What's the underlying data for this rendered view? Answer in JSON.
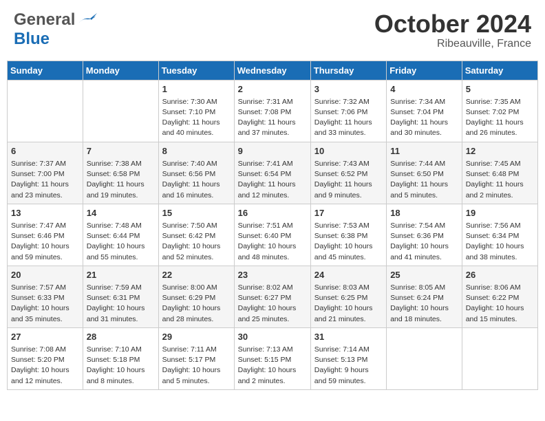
{
  "header": {
    "logo_general": "General",
    "logo_blue": "Blue",
    "month": "October 2024",
    "location": "Ribeauville, France"
  },
  "days_of_week": [
    "Sunday",
    "Monday",
    "Tuesday",
    "Wednesday",
    "Thursday",
    "Friday",
    "Saturday"
  ],
  "weeks": [
    [
      {
        "day": "",
        "info": ""
      },
      {
        "day": "",
        "info": ""
      },
      {
        "day": "1",
        "info": "Sunrise: 7:30 AM\nSunset: 7:10 PM\nDaylight: 11 hours\nand 40 minutes."
      },
      {
        "day": "2",
        "info": "Sunrise: 7:31 AM\nSunset: 7:08 PM\nDaylight: 11 hours\nand 37 minutes."
      },
      {
        "day": "3",
        "info": "Sunrise: 7:32 AM\nSunset: 7:06 PM\nDaylight: 11 hours\nand 33 minutes."
      },
      {
        "day": "4",
        "info": "Sunrise: 7:34 AM\nSunset: 7:04 PM\nDaylight: 11 hours\nand 30 minutes."
      },
      {
        "day": "5",
        "info": "Sunrise: 7:35 AM\nSunset: 7:02 PM\nDaylight: 11 hours\nand 26 minutes."
      }
    ],
    [
      {
        "day": "6",
        "info": "Sunrise: 7:37 AM\nSunset: 7:00 PM\nDaylight: 11 hours\nand 23 minutes."
      },
      {
        "day": "7",
        "info": "Sunrise: 7:38 AM\nSunset: 6:58 PM\nDaylight: 11 hours\nand 19 minutes."
      },
      {
        "day": "8",
        "info": "Sunrise: 7:40 AM\nSunset: 6:56 PM\nDaylight: 11 hours\nand 16 minutes."
      },
      {
        "day": "9",
        "info": "Sunrise: 7:41 AM\nSunset: 6:54 PM\nDaylight: 11 hours\nand 12 minutes."
      },
      {
        "day": "10",
        "info": "Sunrise: 7:43 AM\nSunset: 6:52 PM\nDaylight: 11 hours\nand 9 minutes."
      },
      {
        "day": "11",
        "info": "Sunrise: 7:44 AM\nSunset: 6:50 PM\nDaylight: 11 hours\nand 5 minutes."
      },
      {
        "day": "12",
        "info": "Sunrise: 7:45 AM\nSunset: 6:48 PM\nDaylight: 11 hours\nand 2 minutes."
      }
    ],
    [
      {
        "day": "13",
        "info": "Sunrise: 7:47 AM\nSunset: 6:46 PM\nDaylight: 10 hours\nand 59 minutes."
      },
      {
        "day": "14",
        "info": "Sunrise: 7:48 AM\nSunset: 6:44 PM\nDaylight: 10 hours\nand 55 minutes."
      },
      {
        "day": "15",
        "info": "Sunrise: 7:50 AM\nSunset: 6:42 PM\nDaylight: 10 hours\nand 52 minutes."
      },
      {
        "day": "16",
        "info": "Sunrise: 7:51 AM\nSunset: 6:40 PM\nDaylight: 10 hours\nand 48 minutes."
      },
      {
        "day": "17",
        "info": "Sunrise: 7:53 AM\nSunset: 6:38 PM\nDaylight: 10 hours\nand 45 minutes."
      },
      {
        "day": "18",
        "info": "Sunrise: 7:54 AM\nSunset: 6:36 PM\nDaylight: 10 hours\nand 41 minutes."
      },
      {
        "day": "19",
        "info": "Sunrise: 7:56 AM\nSunset: 6:34 PM\nDaylight: 10 hours\nand 38 minutes."
      }
    ],
    [
      {
        "day": "20",
        "info": "Sunrise: 7:57 AM\nSunset: 6:33 PM\nDaylight: 10 hours\nand 35 minutes."
      },
      {
        "day": "21",
        "info": "Sunrise: 7:59 AM\nSunset: 6:31 PM\nDaylight: 10 hours\nand 31 minutes."
      },
      {
        "day": "22",
        "info": "Sunrise: 8:00 AM\nSunset: 6:29 PM\nDaylight: 10 hours\nand 28 minutes."
      },
      {
        "day": "23",
        "info": "Sunrise: 8:02 AM\nSunset: 6:27 PM\nDaylight: 10 hours\nand 25 minutes."
      },
      {
        "day": "24",
        "info": "Sunrise: 8:03 AM\nSunset: 6:25 PM\nDaylight: 10 hours\nand 21 minutes."
      },
      {
        "day": "25",
        "info": "Sunrise: 8:05 AM\nSunset: 6:24 PM\nDaylight: 10 hours\nand 18 minutes."
      },
      {
        "day": "26",
        "info": "Sunrise: 8:06 AM\nSunset: 6:22 PM\nDaylight: 10 hours\nand 15 minutes."
      }
    ],
    [
      {
        "day": "27",
        "info": "Sunrise: 7:08 AM\nSunset: 5:20 PM\nDaylight: 10 hours\nand 12 minutes."
      },
      {
        "day": "28",
        "info": "Sunrise: 7:10 AM\nSunset: 5:18 PM\nDaylight: 10 hours\nand 8 minutes."
      },
      {
        "day": "29",
        "info": "Sunrise: 7:11 AM\nSunset: 5:17 PM\nDaylight: 10 hours\nand 5 minutes."
      },
      {
        "day": "30",
        "info": "Sunrise: 7:13 AM\nSunset: 5:15 PM\nDaylight: 10 hours\nand 2 minutes."
      },
      {
        "day": "31",
        "info": "Sunrise: 7:14 AM\nSunset: 5:13 PM\nDaylight: 9 hours\nand 59 minutes."
      },
      {
        "day": "",
        "info": ""
      },
      {
        "day": "",
        "info": ""
      }
    ]
  ]
}
